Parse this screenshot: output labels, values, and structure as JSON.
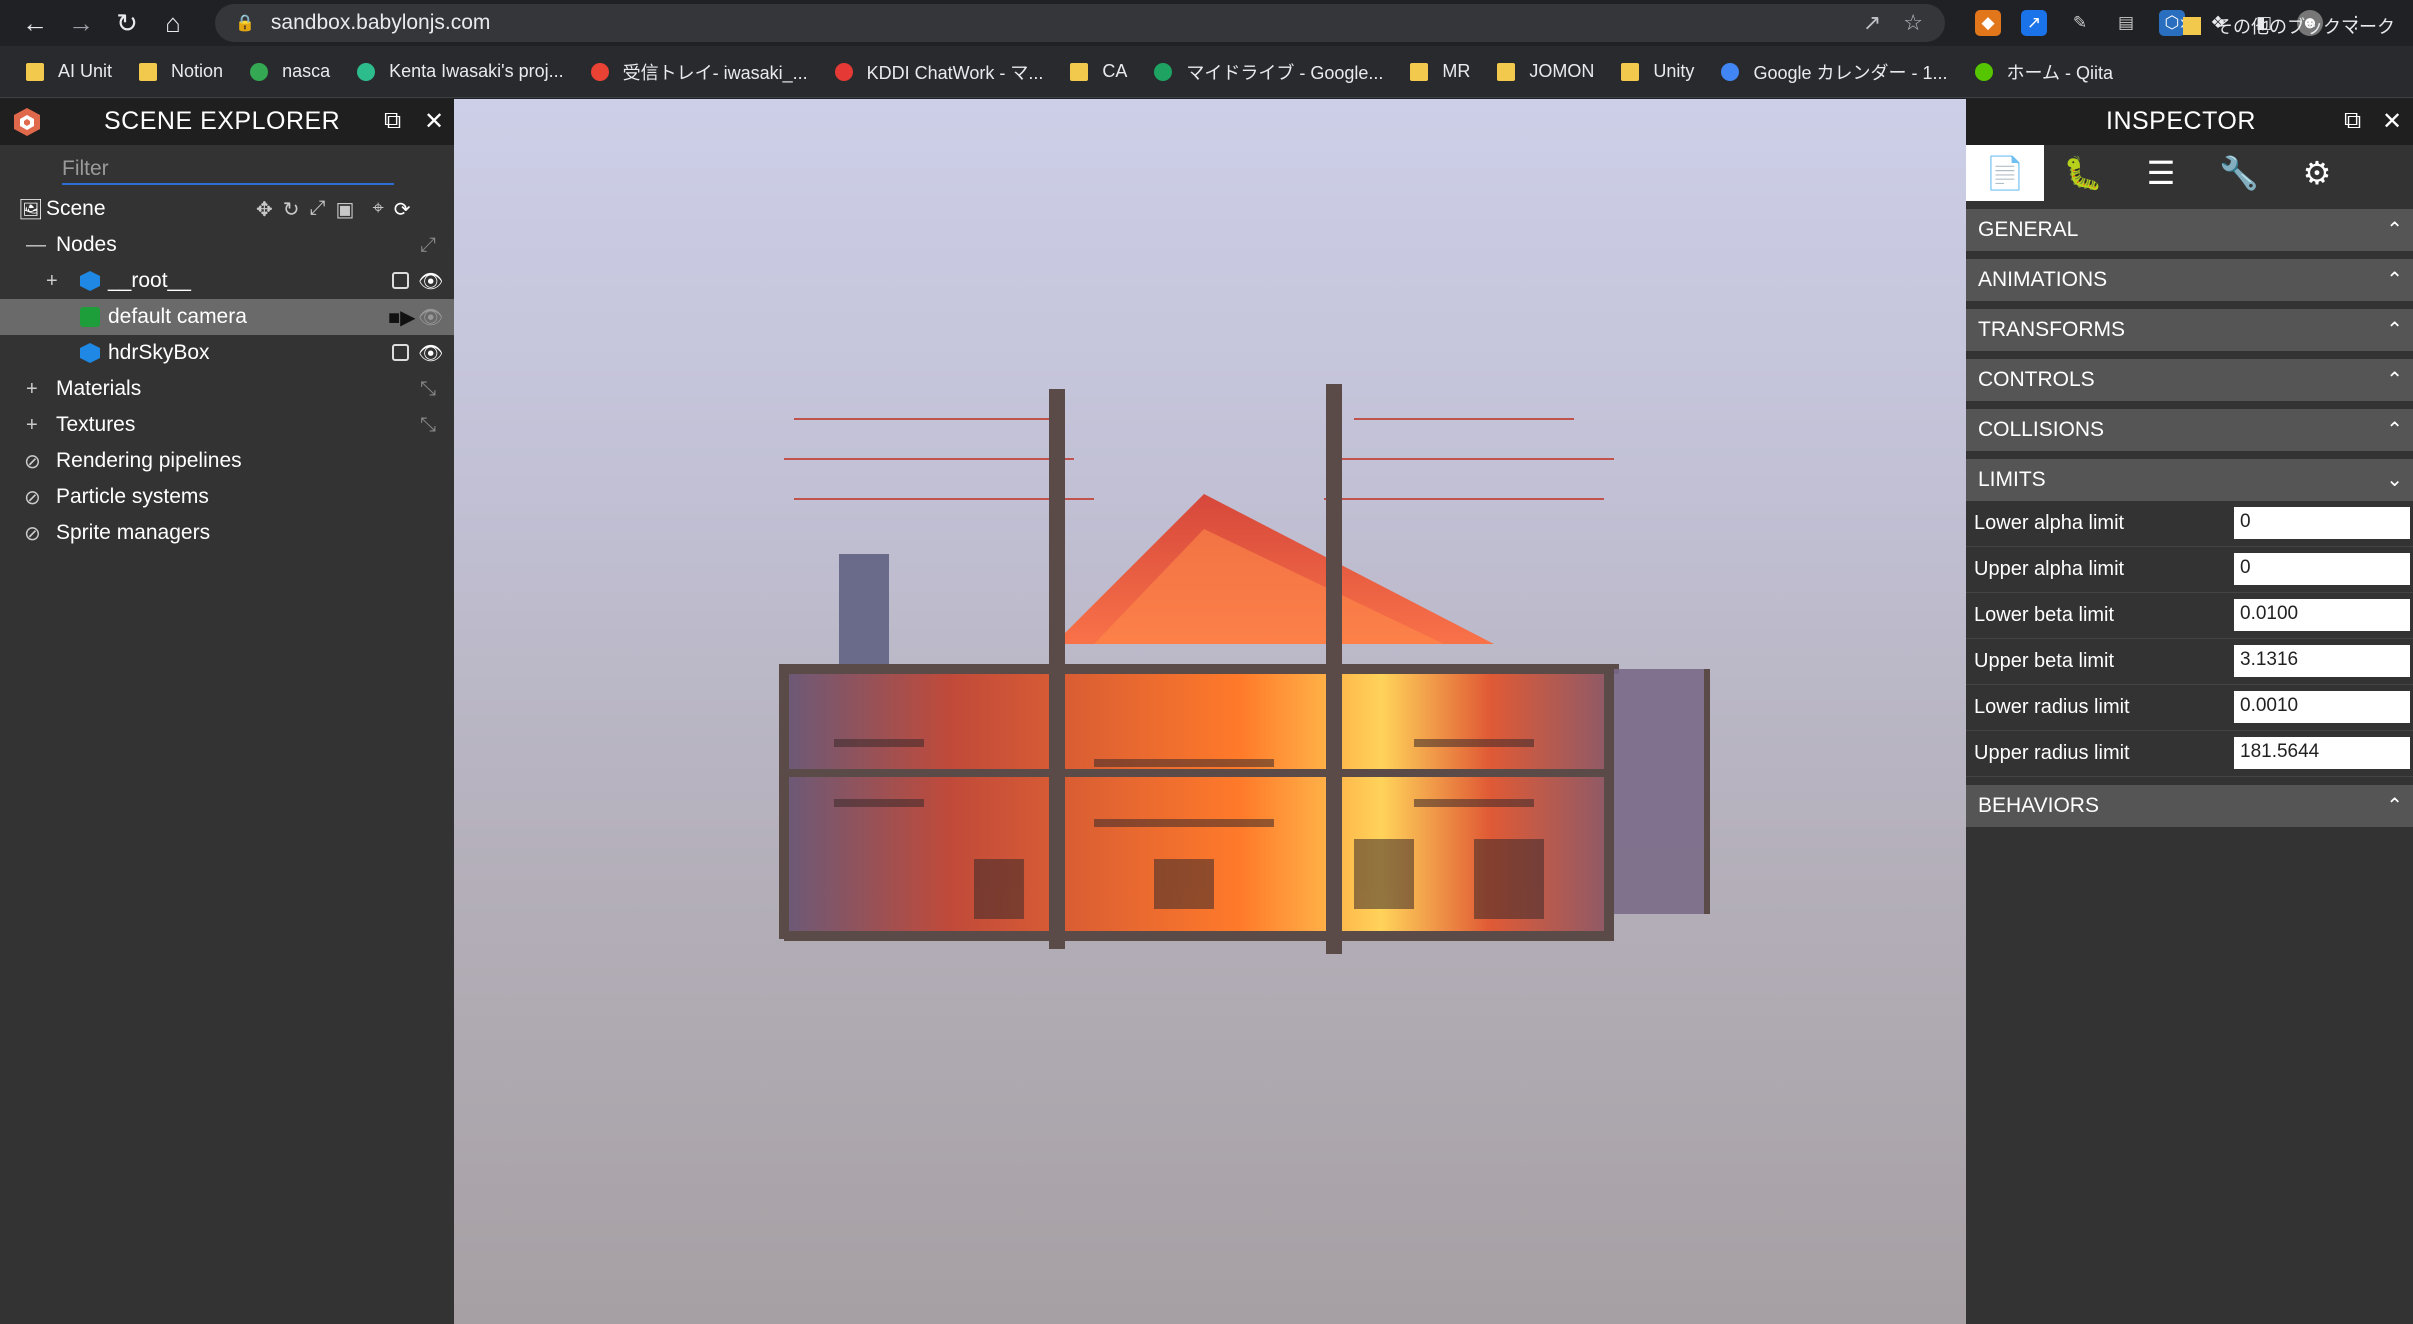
{
  "browser": {
    "url": "sandbox.babylonjs.com",
    "bookmarks": [
      {
        "label": "AI Unit",
        "icon": "folder-icon",
        "color": "#f2c94c"
      },
      {
        "label": "Notion",
        "icon": "folder-icon",
        "color": "#f2c94c"
      },
      {
        "label": "nasca",
        "icon": "nasca-icon",
        "color": "#34a853"
      },
      {
        "label": "Kenta Iwasaki's proj...",
        "icon": "project-icon",
        "color": "#2dbd8c"
      },
      {
        "label": "受信トレイ- iwasaki_...",
        "icon": "gmail-icon",
        "color": "#ea4335"
      },
      {
        "label": "KDDI ChatWork - マ...",
        "icon": "chatwork-icon",
        "color": "#e53935"
      },
      {
        "label": "CA",
        "icon": "folder-icon",
        "color": "#f2c94c"
      },
      {
        "label": "マイドライブ - Google...",
        "icon": "drive-icon",
        "color": "#1ea362"
      },
      {
        "label": "MR",
        "icon": "folder-icon",
        "color": "#f2c94c"
      },
      {
        "label": "JOMON",
        "icon": "folder-icon",
        "color": "#f2c94c"
      },
      {
        "label": "Unity",
        "icon": "folder-icon",
        "color": "#f2c94c"
      },
      {
        "label": "Google カレンダー - 1...",
        "icon": "calendar-icon",
        "color": "#4285f4"
      },
      {
        "label": "ホーム - Qiita",
        "icon": "qiita-icon",
        "color": "#55c500"
      }
    ],
    "more": "»",
    "other_bookmarks": "その他のブックマーク"
  },
  "explorer": {
    "title": "SCENE EXPLORER",
    "filter_placeholder": "Filter",
    "scene_label": "Scene",
    "nodes_label": "Nodes",
    "root_label": "__root__",
    "camera_label": "default camera",
    "skybox_label": "hdrSkyBox",
    "materials_label": "Materials",
    "textures_label": "Textures",
    "rendering_label": "Rendering pipelines",
    "particles_label": "Particle systems",
    "sprites_label": "Sprite managers"
  },
  "inspector": {
    "title": "INSPECTOR",
    "sections": {
      "general": "GENERAL",
      "animations": "ANIMATIONS",
      "transforms": "TRANSFORMS",
      "controls": "CONTROLS",
      "collisions": "COLLISIONS",
      "limits": "LIMITS",
      "behaviors": "BEHAVIORS"
    },
    "limits": [
      {
        "label": "Lower alpha limit",
        "value": "0"
      },
      {
        "label": "Upper alpha limit",
        "value": "0"
      },
      {
        "label": "Lower beta limit",
        "value": "0.0100"
      },
      {
        "label": "Upper beta limit",
        "value": "3.1316"
      },
      {
        "label": "Lower radius limit",
        "value": "0.0010"
      },
      {
        "label": "Upper radius limit",
        "value": "181.5644"
      }
    ]
  },
  "colors": {
    "accent": "#2c6ed5",
    "panel": "#333333",
    "header": "#1f1f1f",
    "section": "#555555",
    "camera_green": "#1e9e3a",
    "node_blue": "#1f88e5"
  }
}
